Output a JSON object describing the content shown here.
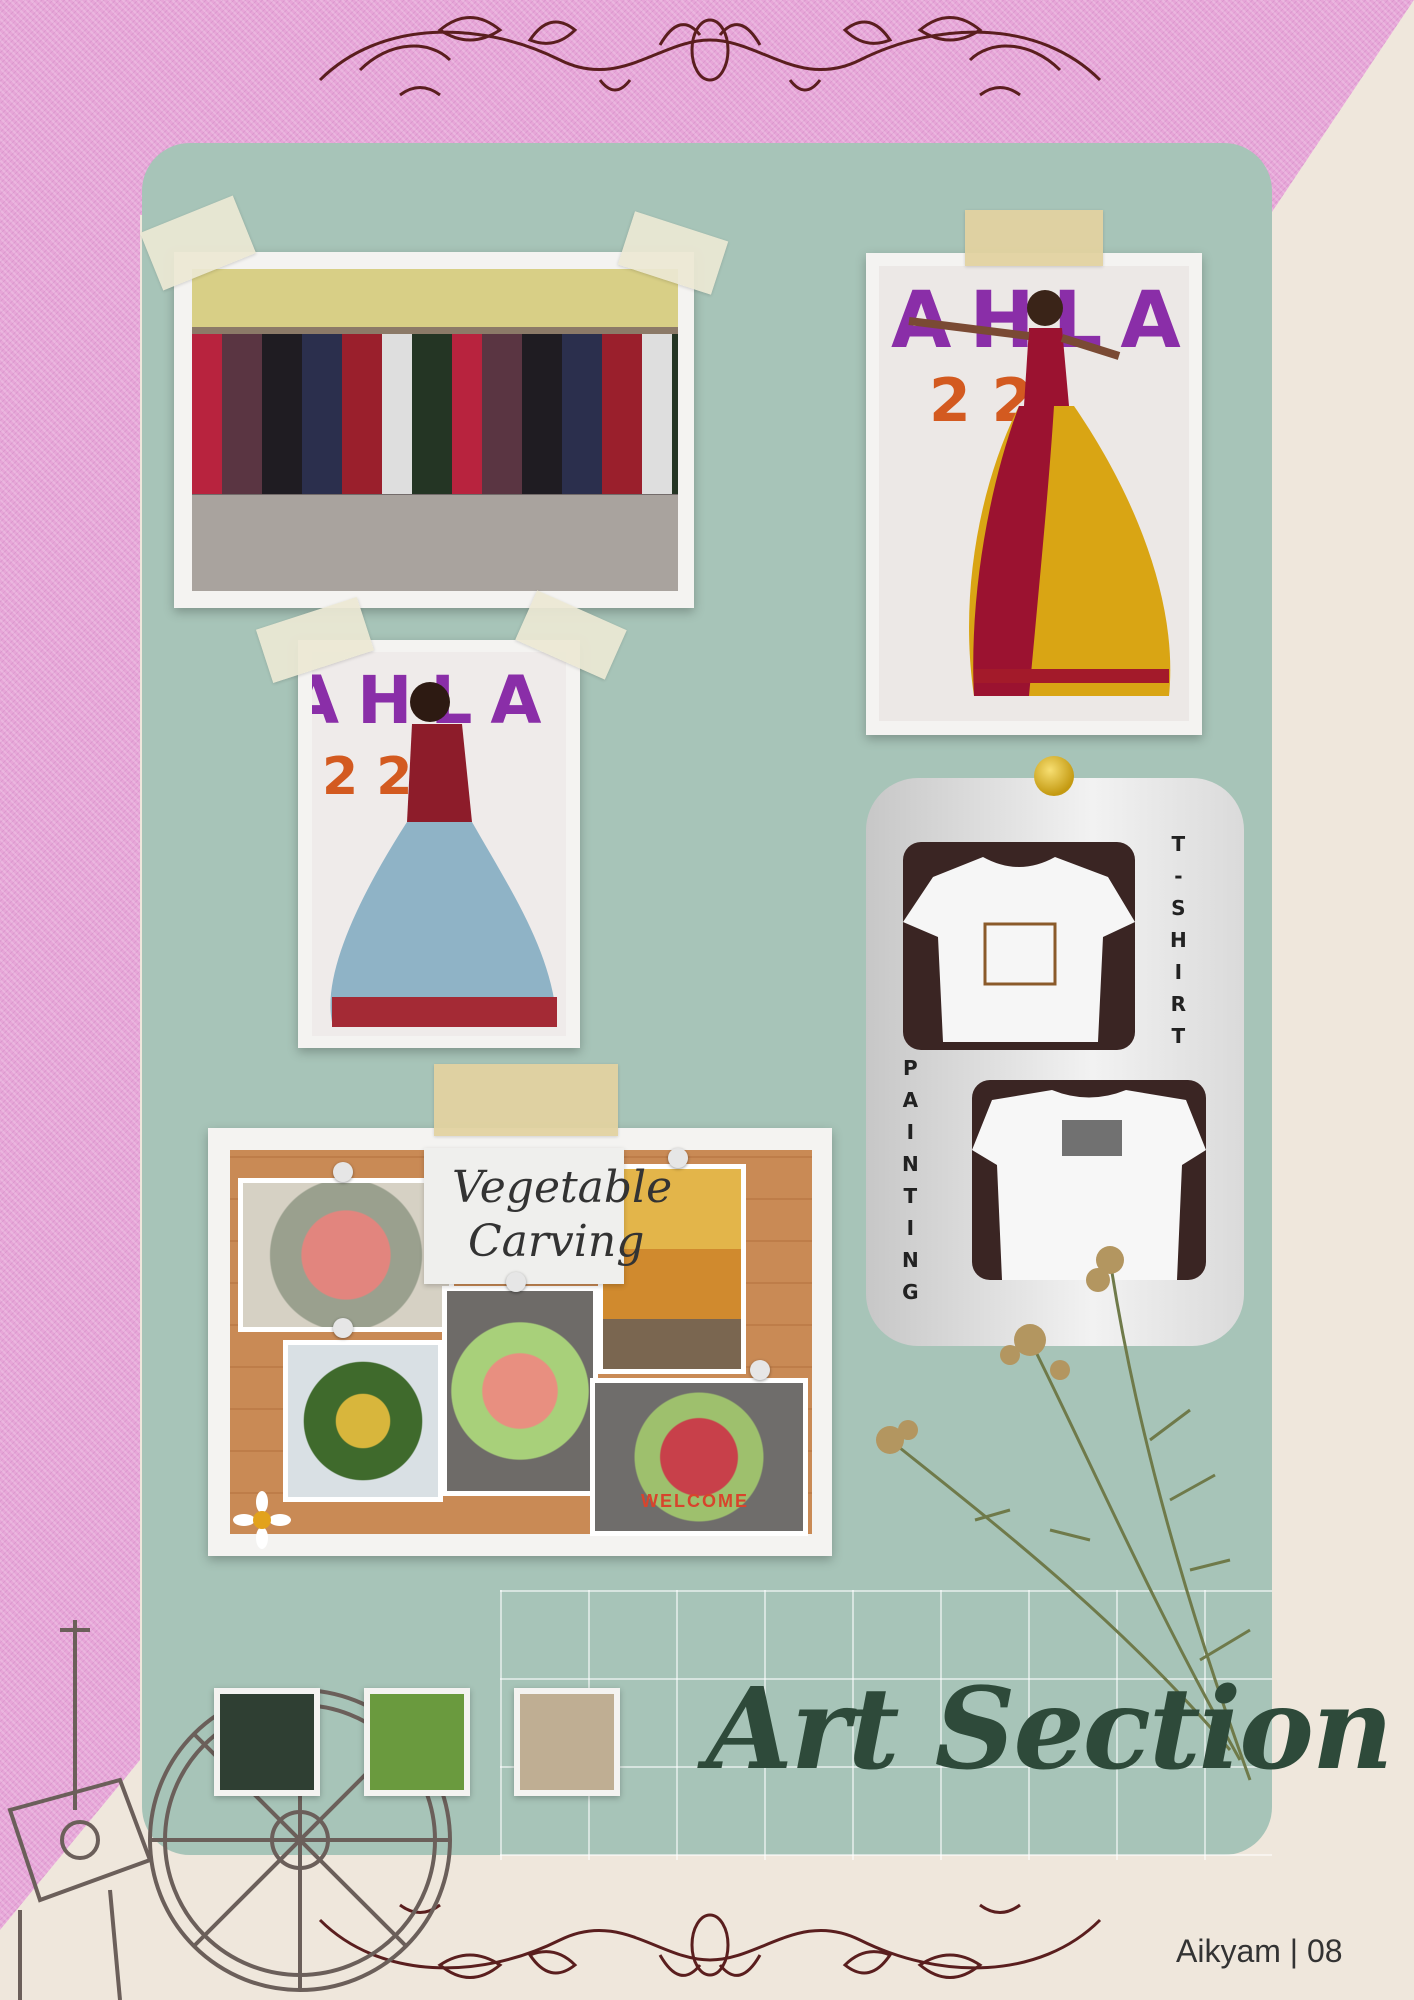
{
  "magazine": {
    "name": "Aikyam",
    "page_number": "08",
    "footer": "Aikyam | 08"
  },
  "section": {
    "title": "Art Section"
  },
  "banner": {
    "letters": "AHLA",
    "digits": "2 2"
  },
  "tshirt_painting": {
    "label_vertical_right": [
      "T",
      "-",
      "S",
      "H",
      "I",
      "R",
      "T"
    ],
    "label_vertical_left": [
      "P",
      "A",
      "I",
      "N",
      "T",
      "I",
      "N",
      "G"
    ]
  },
  "vegetable_carving": {
    "title_line1": "Vegetable",
    "title_line2": "Carving",
    "plate_text": "WELCOME"
  },
  "palette": [
    "#2f3f33",
    "#6a9a3e",
    "#bfae93"
  ],
  "colors": {
    "panel": "#a7c4b8",
    "pink": "#e7a6d8",
    "cream": "#efe7dc",
    "ornament": "#5a1e1e",
    "title": "#2e4a3a"
  }
}
